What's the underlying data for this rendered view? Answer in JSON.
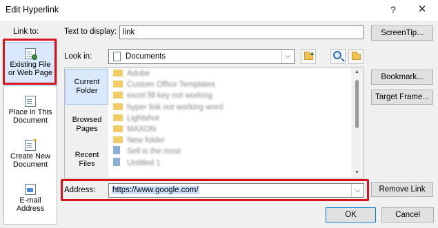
{
  "window": {
    "title": "Edit Hyperlink",
    "help_glyph": "?",
    "close_glyph": "✕"
  },
  "link_to": {
    "label": "Link to:",
    "items": [
      {
        "label_1": "Existing File",
        "label_2": "or Web Page",
        "icon": "existing-file-icon"
      },
      {
        "label_1": "Place in This",
        "label_2": "Document",
        "icon": "place-in-document-icon"
      },
      {
        "label_1": "Create New",
        "label_2": "Document",
        "icon": "new-document-icon"
      },
      {
        "label_1": "E-mail",
        "label_2": "Address",
        "icon": "email-icon"
      }
    ]
  },
  "text_to_display": {
    "label": "Text to display:",
    "value": "link"
  },
  "look_in": {
    "label": "Look in:",
    "value": "Documents"
  },
  "nav": {
    "current_1": "Current",
    "current_2": "Folder",
    "browsed_1": "Browsed",
    "browsed_2": "Pages",
    "recent_1": "Recent",
    "recent_2": "Files"
  },
  "files": [
    {
      "name": "Adobe",
      "type": "folder"
    },
    {
      "name": "Custom Office Templates",
      "type": "folder"
    },
    {
      "name": "excel fill key not working",
      "type": "folder"
    },
    {
      "name": "hyper link not working word",
      "type": "folder"
    },
    {
      "name": "Lightshot",
      "type": "folder"
    },
    {
      "name": "MAXON",
      "type": "folder"
    },
    {
      "name": "New folder",
      "type": "folder"
    },
    {
      "name": "Sell is the most",
      "type": "doc"
    },
    {
      "name": "Untitled 1",
      "type": "doc"
    }
  ],
  "address": {
    "label": "Address:",
    "value": "https://www.google.com/"
  },
  "buttons": {
    "screentip": "ScreenTip...",
    "bookmark": "Bookmark...",
    "target_frame": "Target Frame...",
    "remove_link": "Remove Link",
    "ok": "OK",
    "cancel": "Cancel"
  },
  "colors": {
    "highlight_border": "#d7131b",
    "selected_bg": "#d9e8fb"
  }
}
